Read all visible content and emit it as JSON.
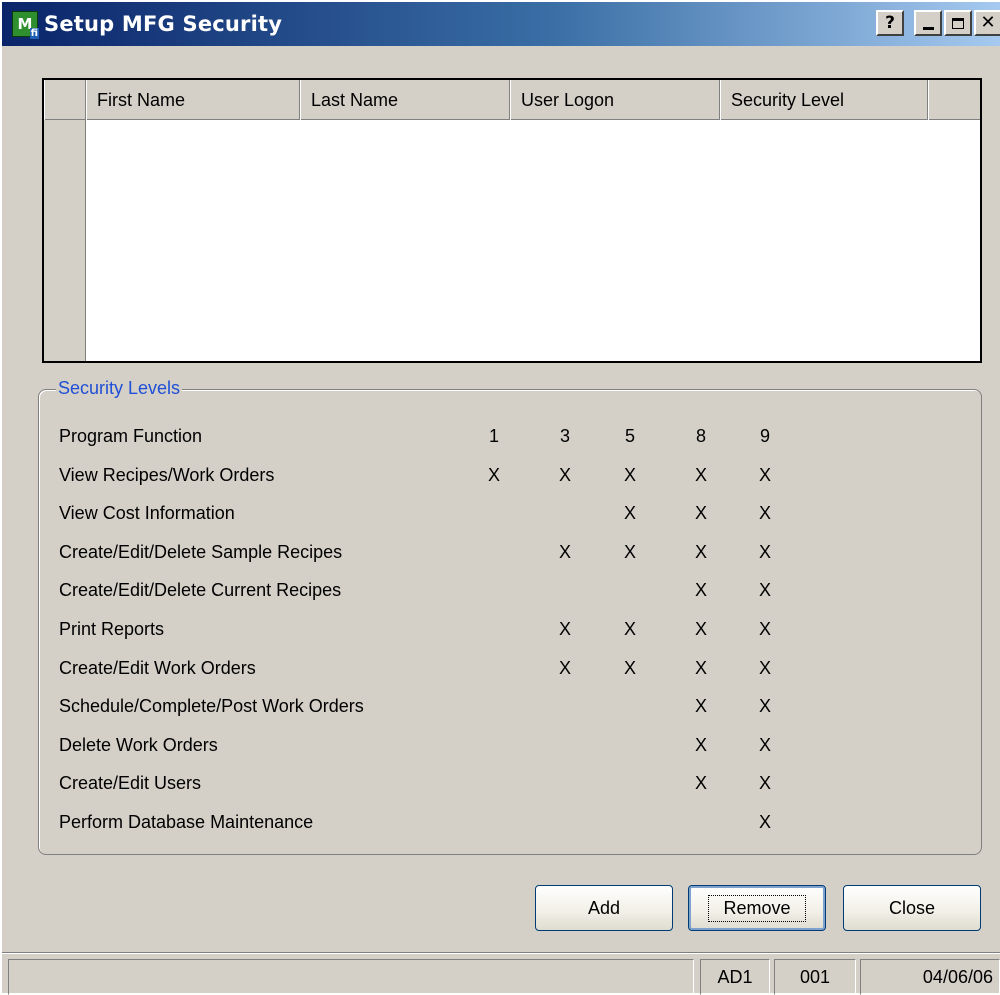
{
  "window": {
    "title": "Setup MFG Security",
    "icon_letter": "M",
    "icon_sub": "fi",
    "help_label": "?",
    "close_glyph": "✕"
  },
  "grid": {
    "columns": [
      "First Name",
      "Last Name",
      "User Logon",
      "Security Level"
    ],
    "rows": []
  },
  "security_levels": {
    "legend": "Security Levels",
    "header": {
      "label": "Program Function",
      "levels": [
        "1",
        "3",
        "5",
        "8",
        "9"
      ]
    },
    "rows": [
      {
        "label": "View Recipes/Work Orders",
        "marks": [
          "X",
          "X",
          "X",
          "X",
          "X"
        ]
      },
      {
        "label": "View Cost Information",
        "marks": [
          "",
          "",
          "X",
          "X",
          "X"
        ]
      },
      {
        "label": "Create/Edit/Delete Sample Recipes",
        "marks": [
          "",
          "X",
          "X",
          "X",
          "X"
        ]
      },
      {
        "label": "Create/Edit/Delete Current Recipes",
        "marks": [
          "",
          "",
          "",
          "X",
          "X"
        ]
      },
      {
        "label": "Print Reports",
        "marks": [
          "",
          "X",
          "X",
          "X",
          "X"
        ]
      },
      {
        "label": "Create/Edit Work Orders",
        "marks": [
          "",
          "X",
          "X",
          "X",
          "X"
        ]
      },
      {
        "label": "Schedule/Complete/Post Work Orders",
        "marks": [
          "",
          "",
          "",
          "X",
          "X"
        ]
      },
      {
        "label": "Delete Work Orders",
        "marks": [
          "",
          "",
          "",
          "X",
          "X"
        ]
      },
      {
        "label": "Create/Edit Users",
        "marks": [
          "",
          "",
          "",
          "X",
          "X"
        ]
      },
      {
        "label": "Perform Database Maintenance",
        "marks": [
          "",
          "",
          "",
          "",
          "X"
        ]
      }
    ]
  },
  "buttons": {
    "add": "Add",
    "remove": "Remove",
    "close": "Close"
  },
  "status": {
    "main": "",
    "user": "AD1",
    "company": "001",
    "date": "04/06/06"
  },
  "colors": {
    "title_gradient_start": "#0a246a",
    "title_gradient_end": "#a6caf0",
    "dialog_background": "#d4d0c8",
    "group_legend": "#1f4fd6"
  }
}
